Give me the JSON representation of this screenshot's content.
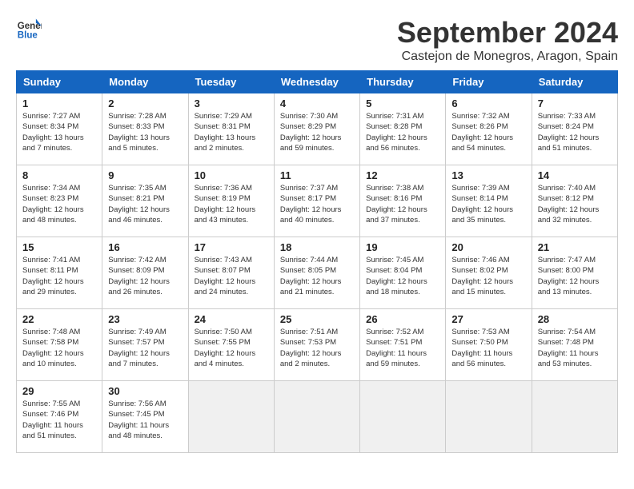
{
  "header": {
    "logo_general": "General",
    "logo_blue": "Blue",
    "month": "September 2024",
    "location": "Castejon de Monegros, Aragon, Spain"
  },
  "weekdays": [
    "Sunday",
    "Monday",
    "Tuesday",
    "Wednesday",
    "Thursday",
    "Friday",
    "Saturday"
  ],
  "weeks": [
    [
      {
        "day": "1",
        "sunrise": "Sunrise: 7:27 AM",
        "sunset": "Sunset: 8:34 PM",
        "daylight": "Daylight: 13 hours and 7 minutes."
      },
      {
        "day": "2",
        "sunrise": "Sunrise: 7:28 AM",
        "sunset": "Sunset: 8:33 PM",
        "daylight": "Daylight: 13 hours and 5 minutes."
      },
      {
        "day": "3",
        "sunrise": "Sunrise: 7:29 AM",
        "sunset": "Sunset: 8:31 PM",
        "daylight": "Daylight: 13 hours and 2 minutes."
      },
      {
        "day": "4",
        "sunrise": "Sunrise: 7:30 AM",
        "sunset": "Sunset: 8:29 PM",
        "daylight": "Daylight: 12 hours and 59 minutes."
      },
      {
        "day": "5",
        "sunrise": "Sunrise: 7:31 AM",
        "sunset": "Sunset: 8:28 PM",
        "daylight": "Daylight: 12 hours and 56 minutes."
      },
      {
        "day": "6",
        "sunrise": "Sunrise: 7:32 AM",
        "sunset": "Sunset: 8:26 PM",
        "daylight": "Daylight: 12 hours and 54 minutes."
      },
      {
        "day": "7",
        "sunrise": "Sunrise: 7:33 AM",
        "sunset": "Sunset: 8:24 PM",
        "daylight": "Daylight: 12 hours and 51 minutes."
      }
    ],
    [
      {
        "day": "8",
        "sunrise": "Sunrise: 7:34 AM",
        "sunset": "Sunset: 8:23 PM",
        "daylight": "Daylight: 12 hours and 48 minutes."
      },
      {
        "day": "9",
        "sunrise": "Sunrise: 7:35 AM",
        "sunset": "Sunset: 8:21 PM",
        "daylight": "Daylight: 12 hours and 46 minutes."
      },
      {
        "day": "10",
        "sunrise": "Sunrise: 7:36 AM",
        "sunset": "Sunset: 8:19 PM",
        "daylight": "Daylight: 12 hours and 43 minutes."
      },
      {
        "day": "11",
        "sunrise": "Sunrise: 7:37 AM",
        "sunset": "Sunset: 8:17 PM",
        "daylight": "Daylight: 12 hours and 40 minutes."
      },
      {
        "day": "12",
        "sunrise": "Sunrise: 7:38 AM",
        "sunset": "Sunset: 8:16 PM",
        "daylight": "Daylight: 12 hours and 37 minutes."
      },
      {
        "day": "13",
        "sunrise": "Sunrise: 7:39 AM",
        "sunset": "Sunset: 8:14 PM",
        "daylight": "Daylight: 12 hours and 35 minutes."
      },
      {
        "day": "14",
        "sunrise": "Sunrise: 7:40 AM",
        "sunset": "Sunset: 8:12 PM",
        "daylight": "Daylight: 12 hours and 32 minutes."
      }
    ],
    [
      {
        "day": "15",
        "sunrise": "Sunrise: 7:41 AM",
        "sunset": "Sunset: 8:11 PM",
        "daylight": "Daylight: 12 hours and 29 minutes."
      },
      {
        "day": "16",
        "sunrise": "Sunrise: 7:42 AM",
        "sunset": "Sunset: 8:09 PM",
        "daylight": "Daylight: 12 hours and 26 minutes."
      },
      {
        "day": "17",
        "sunrise": "Sunrise: 7:43 AM",
        "sunset": "Sunset: 8:07 PM",
        "daylight": "Daylight: 12 hours and 24 minutes."
      },
      {
        "day": "18",
        "sunrise": "Sunrise: 7:44 AM",
        "sunset": "Sunset: 8:05 PM",
        "daylight": "Daylight: 12 hours and 21 minutes."
      },
      {
        "day": "19",
        "sunrise": "Sunrise: 7:45 AM",
        "sunset": "Sunset: 8:04 PM",
        "daylight": "Daylight: 12 hours and 18 minutes."
      },
      {
        "day": "20",
        "sunrise": "Sunrise: 7:46 AM",
        "sunset": "Sunset: 8:02 PM",
        "daylight": "Daylight: 12 hours and 15 minutes."
      },
      {
        "day": "21",
        "sunrise": "Sunrise: 7:47 AM",
        "sunset": "Sunset: 8:00 PM",
        "daylight": "Daylight: 12 hours and 13 minutes."
      }
    ],
    [
      {
        "day": "22",
        "sunrise": "Sunrise: 7:48 AM",
        "sunset": "Sunset: 7:58 PM",
        "daylight": "Daylight: 12 hours and 10 minutes."
      },
      {
        "day": "23",
        "sunrise": "Sunrise: 7:49 AM",
        "sunset": "Sunset: 7:57 PM",
        "daylight": "Daylight: 12 hours and 7 minutes."
      },
      {
        "day": "24",
        "sunrise": "Sunrise: 7:50 AM",
        "sunset": "Sunset: 7:55 PM",
        "daylight": "Daylight: 12 hours and 4 minutes."
      },
      {
        "day": "25",
        "sunrise": "Sunrise: 7:51 AM",
        "sunset": "Sunset: 7:53 PM",
        "daylight": "Daylight: 12 hours and 2 minutes."
      },
      {
        "day": "26",
        "sunrise": "Sunrise: 7:52 AM",
        "sunset": "Sunset: 7:51 PM",
        "daylight": "Daylight: 11 hours and 59 minutes."
      },
      {
        "day": "27",
        "sunrise": "Sunrise: 7:53 AM",
        "sunset": "Sunset: 7:50 PM",
        "daylight": "Daylight: 11 hours and 56 minutes."
      },
      {
        "day": "28",
        "sunrise": "Sunrise: 7:54 AM",
        "sunset": "Sunset: 7:48 PM",
        "daylight": "Daylight: 11 hours and 53 minutes."
      }
    ],
    [
      {
        "day": "29",
        "sunrise": "Sunrise: 7:55 AM",
        "sunset": "Sunset: 7:46 PM",
        "daylight": "Daylight: 11 hours and 51 minutes."
      },
      {
        "day": "30",
        "sunrise": "Sunrise: 7:56 AM",
        "sunset": "Sunset: 7:45 PM",
        "daylight": "Daylight: 11 hours and 48 minutes."
      },
      null,
      null,
      null,
      null,
      null
    ]
  ]
}
